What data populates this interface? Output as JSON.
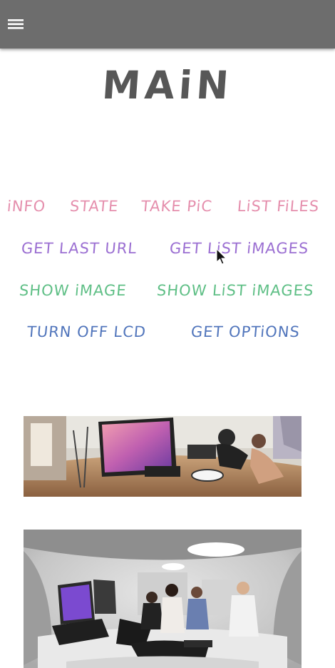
{
  "header": {
    "menu_icon": "hamburger-menu-icon",
    "background": "#6d6d6d"
  },
  "title": "MAiN",
  "commands": {
    "row1": {
      "info": "iNFO",
      "state": "STATE",
      "take_pic": "TAKE PiC",
      "list_files": "LiST FiLES"
    },
    "row2": {
      "get_last_url": "GET LAST URL",
      "get_list_images": "GET LiST iMAGES"
    },
    "row3": {
      "show_image": "SHOW iMAGE",
      "show_list_images": "SHOW LiST iMAGES"
    },
    "row4": {
      "turn_off_lcd": "TURN OFF LCD",
      "get_options": "GET OPTiONS"
    }
  },
  "colors": {
    "pink": "#e58fad",
    "purple": "#9b6fd2",
    "green": "#5fbf86",
    "blue": "#5276bc",
    "title": "#575757"
  },
  "images": [
    {
      "description_icon": "panorama-thumbnail-icon"
    },
    {
      "description_icon": "panorama-thumbnail-icon"
    }
  ]
}
